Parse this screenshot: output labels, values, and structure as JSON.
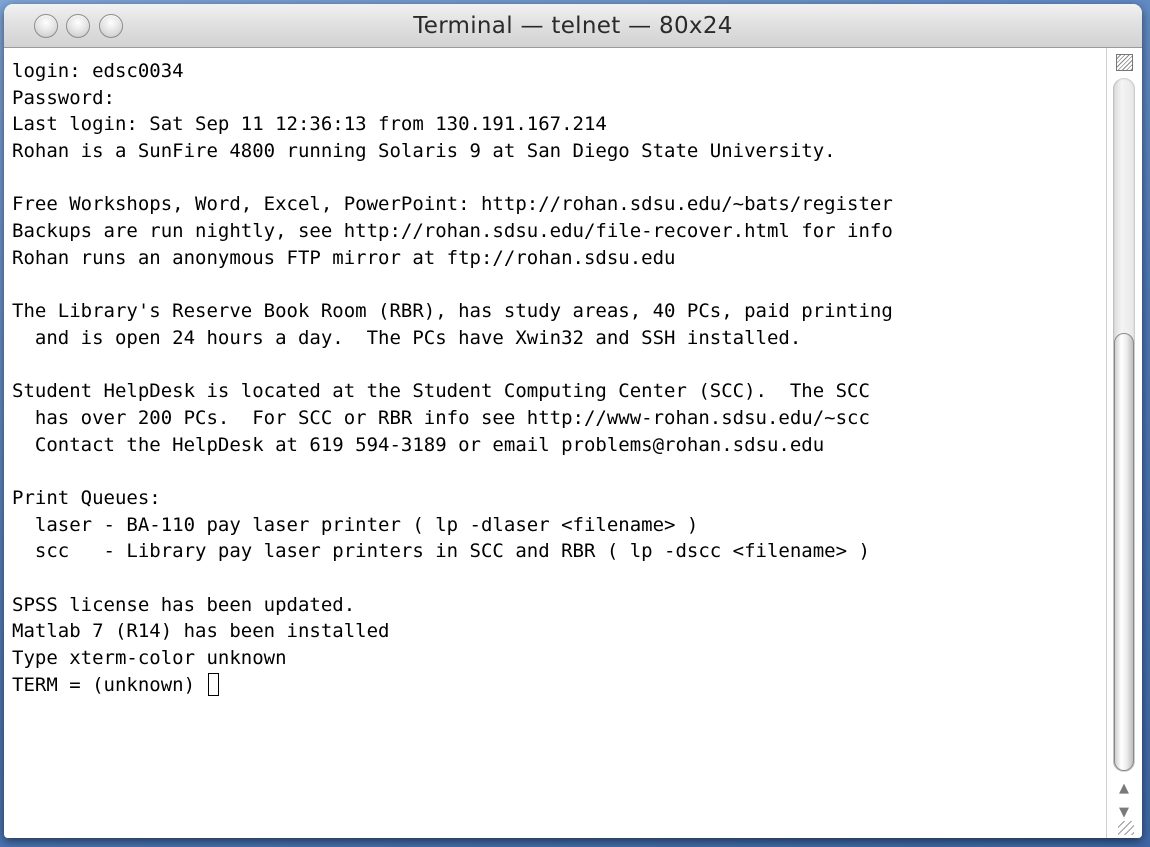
{
  "window": {
    "title": "Terminal — telnet — 80x24"
  },
  "terminal": {
    "lines": [
      "login: edsc0034",
      "Password:",
      "Last login: Sat Sep 11 12:36:13 from 130.191.167.214",
      "Rohan is a SunFire 4800 running Solaris 9 at San Diego State University.",
      "",
      "Free Workshops, Word, Excel, PowerPoint: http://rohan.sdsu.edu/~bats/register",
      "Backups are run nightly, see http://rohan.sdsu.edu/file-recover.html for info",
      "Rohan runs an anonymous FTP mirror at ftp://rohan.sdsu.edu",
      "",
      "The Library's Reserve Book Room (RBR), has study areas, 40 PCs, paid printing",
      "  and is open 24 hours a day.  The PCs have Xwin32 and SSH installed.",
      "",
      "Student HelpDesk is located at the Student Computing Center (SCC).  The SCC",
      "  has over 200 PCs.  For SCC or RBR info see http://www-rohan.sdsu.edu/~scc",
      "  Contact the HelpDesk at 619 594-3189 or email problems@rohan.sdsu.edu",
      "",
      "Print Queues:",
      "  laser - BA-110 pay laser printer ( lp -dlaser <filename> )",
      "  scc   - Library pay laser printers in SCC and RBR ( lp -dscc <filename> )",
      "",
      "SPSS license has been updated.",
      "Matlab 7 (R14) has been installed",
      "Type xterm-color unknown"
    ],
    "prompt": "TERM = (unknown) "
  },
  "scrollbar": {
    "up_arrow": "▲",
    "down_arrow": "▼"
  }
}
